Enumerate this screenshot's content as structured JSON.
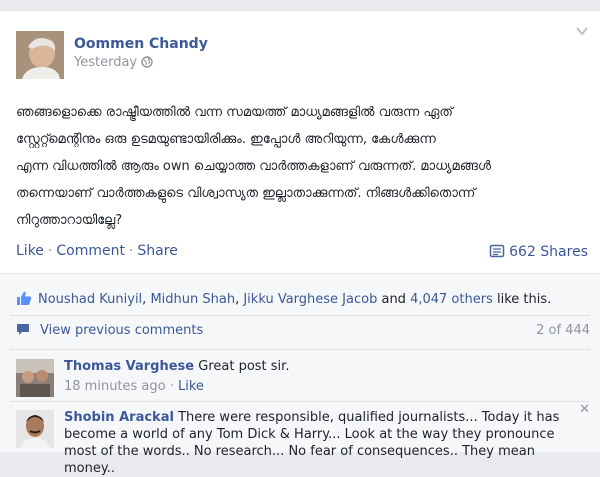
{
  "post": {
    "author": "Oommen Chandy",
    "time": "Yesterday",
    "text_lines": [
      "ഞങ്ങളൊക്കെ രാഷ്ട്രീയത്തിൽ വന്ന സമയത്ത് മാധ്യമങ്ങളിൽ വരുന്ന ഏത്",
      "സ്റ്റേറ്റ്മെന്റിനും ഒരു ഉടമയുണ്ടായിരിക്കും. ഇപ്പോൾ അറിയുന്ന, കേൾക്കുന്ന",
      "എന്ന വിധത്തിൽ ആരും own ചെയ്യാത്ത വാർത്തകളാണ് വരുന്നത്. മാധ്യമങ്ങൾ",
      "തന്നെയാണ് വാർത്തകളുടെ വിശ്വാസ്യത ഇല്ലാതാക്കുന്നത്. നിങ്ങൾക്കിതൊന്ന്",
      "നിറുത്താറായില്ലേ?"
    ],
    "actions": {
      "like": "Like",
      "comment": "Comment",
      "share": "Share",
      "shares": "662 Shares"
    }
  },
  "likes": {
    "names": [
      "Noushad Kuniyil",
      "Midhun Shah",
      "Jikku Varghese Jacob"
    ],
    "sep": ", ",
    "and": " and ",
    "others": "4,047 others",
    "tail": " like this."
  },
  "comments_nav": {
    "view_previous": "View previous comments",
    "count": "2 of 444"
  },
  "comments": [
    {
      "author": "Thomas Varghese",
      "text": "Great post sir.",
      "time": "18 minutes ago",
      "like": "Like"
    },
    {
      "author": "Shobin Arackal",
      "text": "There were responsible, qualified journalists... Today it has become a world of any Tom Dick & Harry... Look at the way they pronounce most of the words.. No research... No fear of consequences.. They mean money..",
      "close": "✕"
    }
  ],
  "colors": {
    "link": "#3b5998",
    "meta": "#90949c",
    "feedback_bg": "#f6f7f9"
  },
  "icons": [
    "chevron-down-icon",
    "globe-icon",
    "share-icon",
    "thumbs-up-icon",
    "comment-icon",
    "close-icon"
  ]
}
